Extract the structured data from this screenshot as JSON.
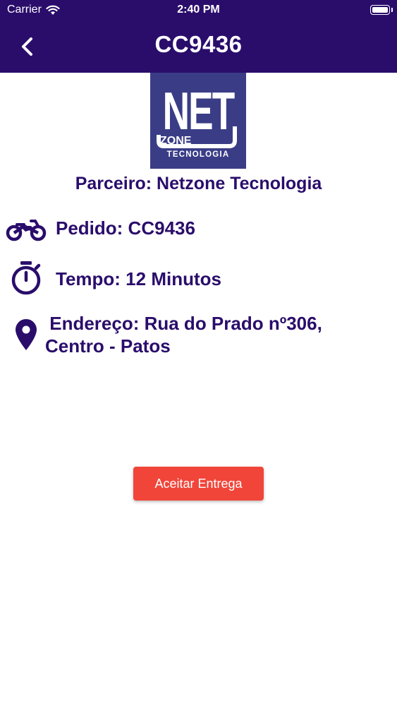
{
  "status_bar": {
    "carrier": "Carrier",
    "time": "2:40 PM"
  },
  "header": {
    "title": "CC9436",
    "back_icon": "chevron-left-icon"
  },
  "logo": {
    "line1": "NET",
    "line2": "ZONE",
    "line3": "TECNOLOGIA"
  },
  "partner": {
    "label": "Parceiro: Netzone Tecnologia"
  },
  "details": {
    "order": {
      "icon": "motorcycle-icon",
      "text": "Pedido: CC9436"
    },
    "time": {
      "icon": "stopwatch-icon",
      "text": "Tempo: 12 Minutos"
    },
    "address": {
      "icon": "location-pin-icon",
      "line1": " Endereço: Rua do Prado nº306,",
      "line2": "Centro - Patos"
    }
  },
  "actions": {
    "accept_label": "Aceitar Entrega"
  },
  "colors": {
    "header_bg": "#2a0d6b",
    "text_primary": "#2a0d6b",
    "accept_button": "#f1453a",
    "logo_bg": "#3a3d86"
  }
}
